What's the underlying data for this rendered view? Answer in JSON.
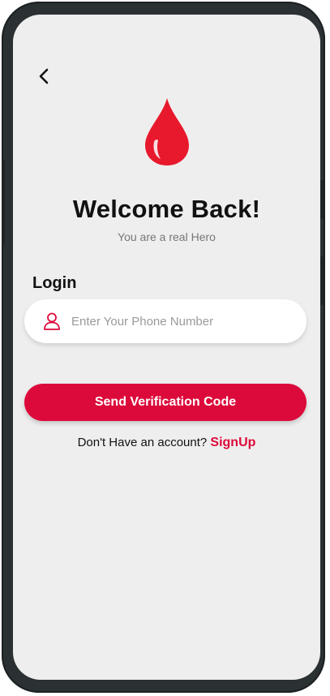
{
  "header": {
    "back_icon": "chevron-left-icon"
  },
  "logo": {
    "icon": "blood-drop-icon",
    "color": "#e8192c"
  },
  "welcome": {
    "title": "Welcome Back!",
    "subtitle": "You are a real Hero"
  },
  "login": {
    "label": "Login",
    "phone_placeholder": "Enter Your Phone Number",
    "phone_value": "",
    "field_icon": "user-icon"
  },
  "actions": {
    "send_label": "Send Verification Code",
    "signup_prompt": "Don't Have an account?",
    "signup_link": "SignUp"
  },
  "colors": {
    "accent": "#dc0a3a",
    "background": "#efeeee"
  }
}
